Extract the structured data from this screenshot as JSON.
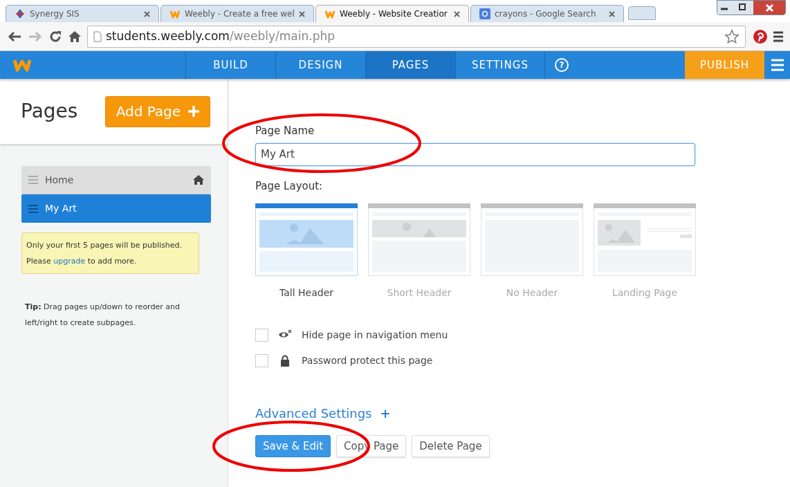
{
  "browser_tabs": [
    {
      "title": "Synergy SIS",
      "kind": "synergy",
      "selected": false
    },
    {
      "title": "Weebly - Create a free wel",
      "kind": "weebly",
      "selected": false
    },
    {
      "title": "Weebly - Website Creatior",
      "kind": "weebly",
      "selected": true
    },
    {
      "title": "crayons - Google Search",
      "kind": "google",
      "selected": false
    }
  ],
  "address": {
    "host": "students.weebly.com",
    "path": "/weebly/main.php"
  },
  "nav": {
    "items": [
      {
        "label": "BUILD",
        "selected": false
      },
      {
        "label": "DESIGN",
        "selected": false
      },
      {
        "label": "PAGES",
        "selected": true
      },
      {
        "label": "SETTINGS",
        "selected": false
      }
    ],
    "help": "?",
    "publish": "PUBLISH"
  },
  "sidebar": {
    "title": "Pages",
    "add_button": "Add Page",
    "pages": [
      {
        "label": "Home",
        "selected": false,
        "home": true
      },
      {
        "label": "My Art",
        "selected": true,
        "home": false
      }
    ],
    "notice": "Only your first 5 pages will be published. Please",
    "notice_link": "upgrade",
    "notice_end": "to add more.",
    "tip": "**Tip:**  Drag pages up/down to reorder and left/right to create subpages."
  },
  "form": {
    "name_label": "Page Name",
    "name_value": "My Art",
    "layout_label": "Page Layout:",
    "layouts": [
      {
        "label": "Tall Header",
        "kind": "tall",
        "selected": true
      },
      {
        "label": "Short Header",
        "kind": "short",
        "selected": false
      },
      {
        "label": "No Header",
        "kind": "none",
        "selected": false
      },
      {
        "label": "Landing Page",
        "kind": "landing",
        "selected": false
      }
    ],
    "options": [
      {
        "label": "Hide page in navigation menu",
        "kind": "hide",
        "checked": false
      },
      {
        "label": "Password protect this page",
        "kind": "password",
        "checked": false
      }
    ],
    "advanced": "Advanced Settings",
    "advanced_icon": "+",
    "buttons": [
      {
        "label": "Save & Edit",
        "kind": "primary"
      },
      {
        "label": "Copy Page",
        "kind": "default"
      },
      {
        "label": "Delete Page",
        "kind": "default"
      }
    ]
  }
}
